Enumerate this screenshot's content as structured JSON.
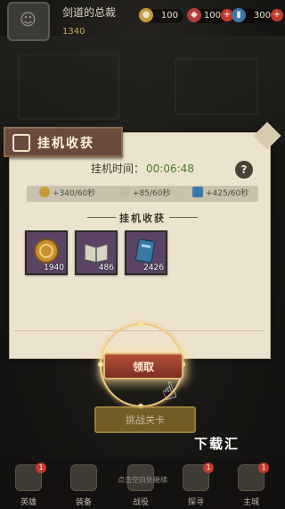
{
  "hud": {
    "player_name": "剑道的总裁",
    "power": "1340",
    "coin": "100",
    "gem": "100",
    "card": "300"
  },
  "panel": {
    "title": "挂机收获",
    "time_label": "挂机时间：",
    "time_value": "00:06:48",
    "help_label": "?",
    "rates": [
      {
        "icon": "coin-icon",
        "label": "+340/60秒"
      },
      {
        "icon": "book-icon",
        "label": "+85/60秒"
      },
      {
        "icon": "card-icon",
        "label": "+425/60秒"
      }
    ],
    "section_title": "挂机收获",
    "items": [
      {
        "icon": "gold-coin-icon",
        "count": "1940"
      },
      {
        "icon": "open-book-icon",
        "count": "486"
      },
      {
        "icon": "blue-card-icon",
        "count": "2426"
      }
    ],
    "claim_label": "领取",
    "challenge_label": "挑战关卡"
  },
  "hint": "点击空白处继续",
  "watermark": "下载汇",
  "bottom_tabs": [
    {
      "label": "英雄",
      "icon": "hero-icon",
      "badge": "1"
    },
    {
      "label": "装备",
      "icon": "equip-icon",
      "badge": ""
    },
    {
      "label": "战役",
      "icon": "battle-icon",
      "badge": ""
    },
    {
      "label": "探寻",
      "icon": "explore-icon",
      "badge": "1"
    },
    {
      "label": "主城",
      "icon": "city-icon",
      "badge": "1"
    }
  ],
  "colors": {
    "accent_gold": "#e1b67a",
    "time_green": "#4c7b35",
    "panel_bg": "#ece3cf",
    "button_red": "#9a3f2d"
  }
}
